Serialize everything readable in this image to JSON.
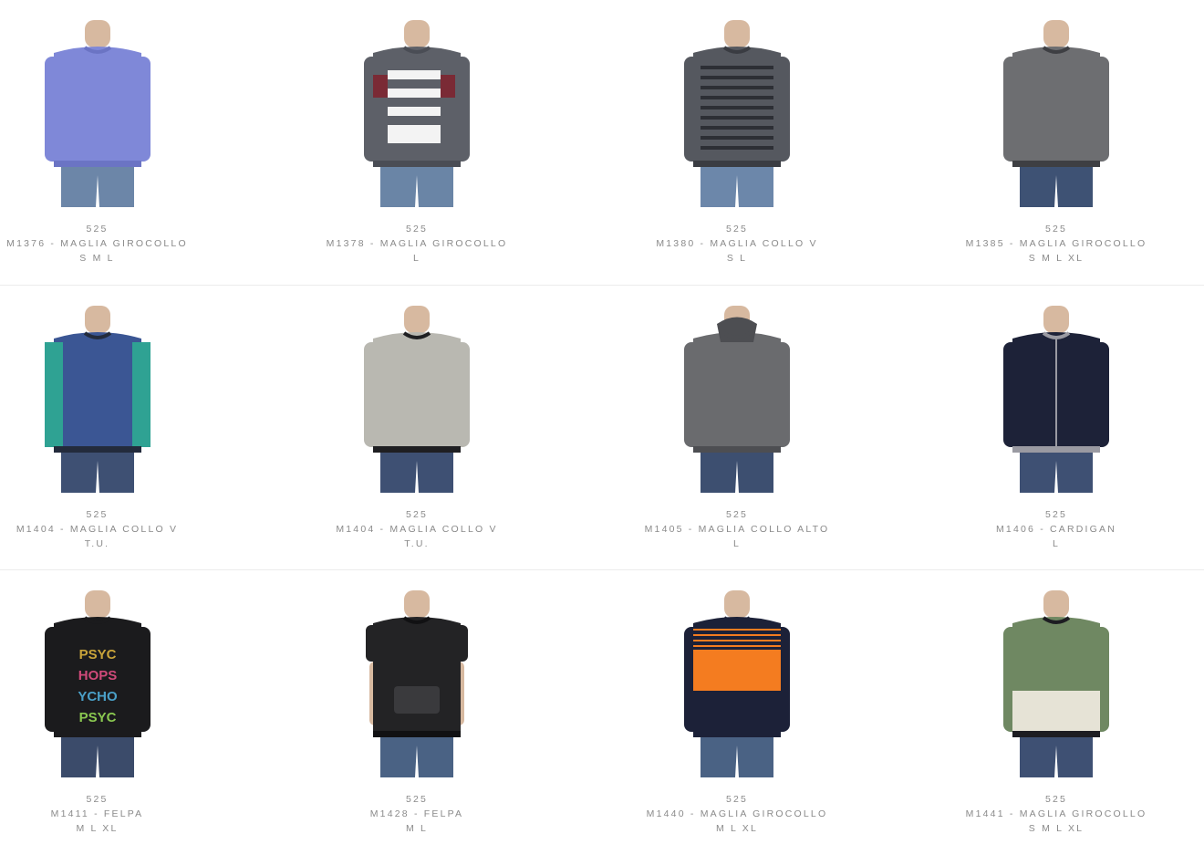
{
  "products": [
    {
      "price": "525",
      "name": "M1376 - MAGLIA GIROCOLLO",
      "sizes": "S M L",
      "colors": {
        "sweater": "#7f88d8",
        "trim": "#6b74c4",
        "accent": "#7f88d8",
        "jeans": "#6c86a8"
      }
    },
    {
      "price": "525",
      "name": "M1378 - MAGLIA GIROCOLLO",
      "sizes": "L",
      "colors": {
        "sweater": "#5d6068",
        "trim": "#4a4d55",
        "accent": "#f3f3f3",
        "jeans": "#6a85a6"
      }
    },
    {
      "price": "525",
      "name": "M1380 - MAGLIA COLLO V",
      "sizes": "S L",
      "colors": {
        "sweater": "#55585f",
        "trim": "#3a3c42",
        "accent": "#2d2f35",
        "jeans": "#6c87aa"
      }
    },
    {
      "price": "525",
      "name": "M1385 - MAGLIA GIROCOLLO",
      "sizes": "S M L XL",
      "colors": {
        "sweater": "#6d6e71",
        "trim": "#3e3f43",
        "accent": "#8a8b8e",
        "jeans": "#3e5274"
      }
    },
    {
      "price": "525",
      "name": "M1404 - MAGLIA COLLO V",
      "sizes": "T.U.",
      "colors": {
        "sweater": "#3b5694",
        "trim": "#232b3c",
        "accent": "#2fa293",
        "jeans": "#3e5073"
      }
    },
    {
      "price": "525",
      "name": "M1404 - MAGLIA COLLO V",
      "sizes": "T.U.",
      "colors": {
        "sweater": "#b9b8b1",
        "trim": "#1f1f22",
        "accent": "#a9a8a1",
        "jeans": "#3e5073"
      }
    },
    {
      "price": "525",
      "name": "M1405 - MAGLIA COLLO ALTO",
      "sizes": "L",
      "colors": {
        "sweater": "#6a6b6e",
        "trim": "#4d4e52",
        "accent": "#5a5b5f",
        "jeans": "#3d4f70"
      }
    },
    {
      "price": "525",
      "name": "M1406 - CARDIGAN",
      "sizes": "L",
      "colors": {
        "sweater": "#1d2238",
        "trim": "#9a9aa2",
        "accent": "#1d2238",
        "jeans": "#3e5073"
      }
    },
    {
      "price": "525",
      "name": "M1411 - FELPA",
      "sizes": "M L XL",
      "colors": {
        "sweater": "#1b1b1d",
        "trim": "#1b1b1d",
        "accent": "#c9a43a",
        "jeans": "#3b4b6a"
      }
    },
    {
      "price": "525",
      "name": "M1428 - FELPA",
      "sizes": "M L",
      "colors": {
        "sweater": "#232325",
        "trim": "#111113",
        "accent": "#3a3a3d",
        "jeans": "#4a6284"
      }
    },
    {
      "price": "525",
      "name": "M1440 - MAGLIA GIROCOLLO",
      "sizes": "M L XL",
      "colors": {
        "sweater": "#1c2138",
        "trim": "#1c2138",
        "accent": "#f47c20",
        "jeans": "#4a6284"
      }
    },
    {
      "price": "525",
      "name": "M1441 - MAGLIA GIROCOLLO",
      "sizes": "S M L XL",
      "colors": {
        "sweater": "#6f8862",
        "trim": "#1d1d22",
        "accent": "#e6e3d6",
        "jeans": "#3e5073"
      }
    }
  ]
}
